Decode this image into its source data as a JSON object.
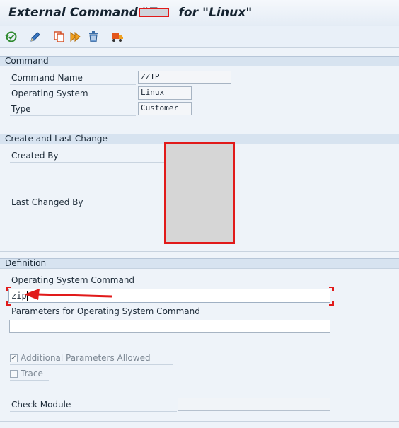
{
  "window": {
    "title": "External Command \"Z     for \"Linux\""
  },
  "toolbar": {
    "icons": [
      "check-other-object-icon",
      "edit-pencil-icon",
      "copy-icon",
      "execute-icon",
      "delete-trash-icon",
      "transport-truck-icon"
    ]
  },
  "command_section": {
    "header": "Command",
    "command_name_label": "Command Name",
    "command_name_value": "ZZIP",
    "os_label": "Operating System",
    "os_value": "Linux",
    "type_label": "Type",
    "type_value": "Customer"
  },
  "change_section": {
    "header": "Create and Last Change",
    "created_by_label": "Created By",
    "last_changed_label": "Last Changed By"
  },
  "definition_section": {
    "header": "Definition",
    "os_command_label": "Operating System Command",
    "os_command_value": "zip",
    "params_label": "Parameters for Operating System Command",
    "params_value": "",
    "additional_params_label": "Additional Parameters Allowed",
    "additional_params_checked": true,
    "trace_label": "Trace",
    "trace_checked": false,
    "check_module_label": "Check Module",
    "check_module_value": ""
  },
  "colors": {
    "annotation_red": "#e11a1a",
    "section_header": "#d7e3f0",
    "background": "#eef3f9"
  }
}
